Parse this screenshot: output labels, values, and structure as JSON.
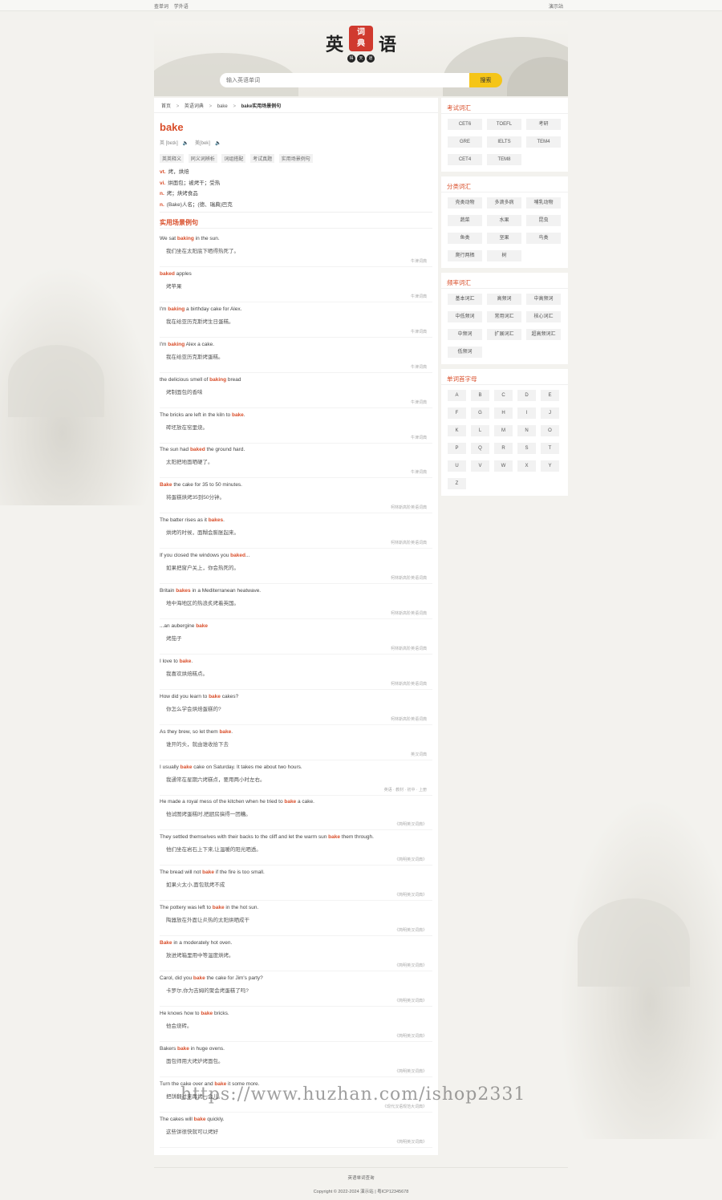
{
  "topbar": {
    "links": [
      "查单词",
      "学外语"
    ],
    "right": "演示站"
  },
  "logo": {
    "chars": [
      "英",
      "语"
    ],
    "seal": [
      "词",
      "典"
    ],
    "sub": [
      "得",
      "天",
      "道"
    ]
  },
  "search": {
    "placeholder": "输入英语单词",
    "button": "搜索"
  },
  "breadcrumb": {
    "items": [
      "首页",
      "英语词典",
      "bake"
    ],
    "current": "bake实用场景例句",
    "sep": ">"
  },
  "word": {
    "headword": "bake",
    "phonetic_uk": "英 [beɪk]",
    "phonetic_us": "美[bek]",
    "speaker_icon": "speaker-icon",
    "tabs": [
      "英英释义",
      "同义词辨析",
      "词组搭配",
      "考试真题",
      "实用场景例句"
    ],
    "definitions": [
      {
        "pos": "vt.",
        "text": "烤，烘焙"
      },
      {
        "pos": "vi.",
        "text": "烘面包；被烤干；受热"
      },
      {
        "pos": "n.",
        "text": "烤；烘烤食品"
      },
      {
        "pos": "n.",
        "text": "(Bake)人名；(德、瑞典)巴克"
      }
    ]
  },
  "examples_title": "实用场景例句",
  "examples": [
    {
      "pre": "We sat ",
      "hl": "baking",
      "post": " in the sun.",
      "zh": "我们坐在太阳底下晒得热死了。",
      "src": "牛津词典"
    },
    {
      "pre": "",
      "hl": "baked",
      "post": " apples",
      "zh": "烤苹果",
      "src": "牛津词典"
    },
    {
      "pre": "I'm ",
      "hl": "baking",
      "post": " a birthday cake for Alex.",
      "zh": "我在给亚历克斯烤生日蛋糕。",
      "src": "牛津词典"
    },
    {
      "pre": "I'm ",
      "hl": "baking",
      "post": " Alex a cake.",
      "zh": "我在给亚历克斯烤蛋糕。",
      "src": "牛津词典"
    },
    {
      "pre": "the delicious smell of ",
      "hl": "baking",
      "post": " bread",
      "zh": "烤制面包的香味",
      "src": "牛津词典"
    },
    {
      "pre": "The bricks are left in the kiln to ",
      "hl": "bake",
      "post": ".",
      "zh": "砖坯放在窑里烧。",
      "src": "牛津词典"
    },
    {
      "pre": "The sun had ",
      "hl": "baked",
      "post": " the ground hard.",
      "zh": "太阳把地面晒硬了。",
      "src": "牛津词典"
    },
    {
      "pre": "",
      "hl": "Bake",
      "post": " the cake for 35 to 50 minutes.",
      "zh": "将蛋糕烘烤35到50分钟。",
      "src": "柯林斯高阶英语词典"
    },
    {
      "pre": "The batter rises as it ",
      "hl": "bakes",
      "post": ".",
      "zh": "烘烤的时候，面糊会膨胀起来。",
      "src": "柯林斯高阶英语词典"
    },
    {
      "pre": "If you closed the windows you ",
      "hl": "baked",
      "post": "...",
      "zh": "如果把窗户关上，你会热死的。",
      "src": "柯林斯高阶英语词典"
    },
    {
      "pre": "Britain ",
      "hl": "bakes",
      "post": " in a Mediterranean heatwave.",
      "zh": "地中海地区的热浪炙烤着英国。",
      "src": "柯林斯高阶英语词典"
    },
    {
      "pre": "...an aubergine ",
      "hl": "bake",
      "post": "",
      "zh": "烤茄子",
      "src": "柯林斯高阶英语词典"
    },
    {
      "pre": "I love to ",
      "hl": "bake",
      "post": ".",
      "zh": "我喜欢烘焙糕点。",
      "src": "柯林斯高阶英语词典"
    },
    {
      "pre": "How did you learn to ",
      "hl": "bake",
      "post": " cakes?",
      "zh": "你怎么学会烘焙蛋糕的?",
      "src": "柯林斯高阶英语词典"
    },
    {
      "pre": "As they brew, so let them ",
      "hl": "bake",
      "post": ".",
      "zh": "谁开的头，就由谁收拾下去",
      "src": "英汉词典"
    },
    {
      "pre": "I usually ",
      "hl": "bake",
      "post": " cake on Saturday. It takes me about two hours.",
      "zh": "我通常在星期六烤糕点，要用两小时左右。",
      "src": "英语 · 教材 · 初中 · 上册"
    },
    {
      "pre": "He made a royal mess of the kitchen when he tried to ",
      "hl": "bake",
      "post": " a cake.",
      "zh": "他试图烤蛋糕时,把厨房搞得一团糟。",
      "src": "《简明英汉词典》"
    },
    {
      "pre": "They settled themselves with their backs to the cliff and let the warm sun ",
      "hl": "bake",
      "post": " them through.",
      "zh": "他们坐在岩石上下来,让温暖的阳光晒透。",
      "src": "《简明英汉词典》"
    },
    {
      "pre": "The bread will not ",
      "hl": "bake",
      "post": " if the fire is too small.",
      "zh": "如果火太小,面包就烤不成",
      "src": "《简明英汉词典》"
    },
    {
      "pre": "The pottery was left to ",
      "hl": "bake",
      "post": " in the hot sun.",
      "zh": "陶器放在外面让炎热的太阳烘晒成干",
      "src": "《简明英汉词典》"
    },
    {
      "pre": "",
      "hl": "Bake",
      "post": " in a moderately hot oven.",
      "zh": "放进烤箱里用中等温度烘烤。",
      "src": "《简明英汉词典》"
    },
    {
      "pre": "Carol, did you ",
      "hl": "bake",
      "post": " the cake for Jim's party?",
      "zh": "卡罗尔,你为吉姆的聚会烤蛋糕了吗?",
      "src": "《简明英汉词典》"
    },
    {
      "pre": "He knows how to ",
      "hl": "bake",
      "post": " bricks.",
      "zh": "他会烧砖。",
      "src": "《简明英汉词典》"
    },
    {
      "pre": "Bakers ",
      "hl": "bake",
      "post": " in huge ovens.",
      "zh": "面包师用大烤炉烤面包。",
      "src": "《简明英汉词典》"
    },
    {
      "pre": "Turn the cake over and ",
      "hl": "bake",
      "post": " it some more.",
      "zh": "把饼翻过来再烤一会儿。",
      "src": "《现代汉语规范大词典》"
    },
    {
      "pre": "The cakes will ",
      "hl": "bake",
      "post": " quickly.",
      "zh": "这些饼很快就可以烤好",
      "src": "《简明英汉词典》"
    }
  ],
  "sidebar": {
    "exam": {
      "title": "考试词汇",
      "tags": [
        "CET6",
        "TOEFL",
        "考研",
        "GRE",
        "IELTS",
        "TEM4",
        "CET4",
        "TEM8"
      ]
    },
    "category": {
      "title": "分类词汇",
      "tags": [
        "壳类动物",
        "多滴多病",
        "哺乳动物",
        "蔬菜",
        "水果",
        "昆虫",
        "鱼类",
        "坚果",
        "鸟类",
        "爬行两栖",
        "树"
      ]
    },
    "frequency": {
      "title": "频率词汇",
      "tags": [
        "基本词汇",
        "高频词",
        "中高频词",
        "中低频词",
        "常用词汇",
        "核心词汇",
        "中频词",
        "扩展词汇",
        "超高频词汇",
        "低频词"
      ]
    },
    "letters": {
      "title": "单词首字母",
      "items": [
        "A",
        "B",
        "C",
        "D",
        "E",
        "F",
        "G",
        "H",
        "I",
        "J",
        "K",
        "L",
        "M",
        "N",
        "O",
        "P",
        "Q",
        "R",
        "S",
        "T",
        "U",
        "V",
        "W",
        "X",
        "Y",
        "Z"
      ]
    }
  },
  "footer": {
    "line1": "英语单词查询",
    "line2": "Copyright © 2022-2024 演示站 | 粤ICP12345678"
  },
  "watermark": "https://www.huzhan.com/ishop2331"
}
